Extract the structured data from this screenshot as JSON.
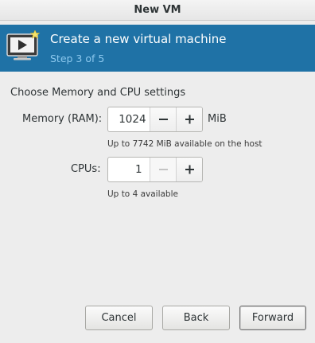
{
  "window": {
    "title": "New VM"
  },
  "banner": {
    "title": "Create a new virtual machine",
    "step": "Step 3 of 5",
    "icon": "vm-screen-play-icon",
    "background": "#1f72a6",
    "step_color": "#8cc8ee"
  },
  "section": {
    "title": "Choose Memory and CPU settings"
  },
  "memory": {
    "label": "Memory (RAM):",
    "value": "1024",
    "unit": "MiB",
    "hint": "Up to 7742 MiB available on the host",
    "decrement_icon": "minus-icon",
    "increment_icon": "plus-icon"
  },
  "cpus": {
    "label": "CPUs:",
    "value": "1",
    "hint": "Up to 4 available",
    "decrement_icon": "minus-icon",
    "decrement_enabled": false,
    "increment_icon": "plus-icon"
  },
  "buttons": {
    "cancel": "Cancel",
    "back": "Back",
    "forward": "Forward"
  }
}
